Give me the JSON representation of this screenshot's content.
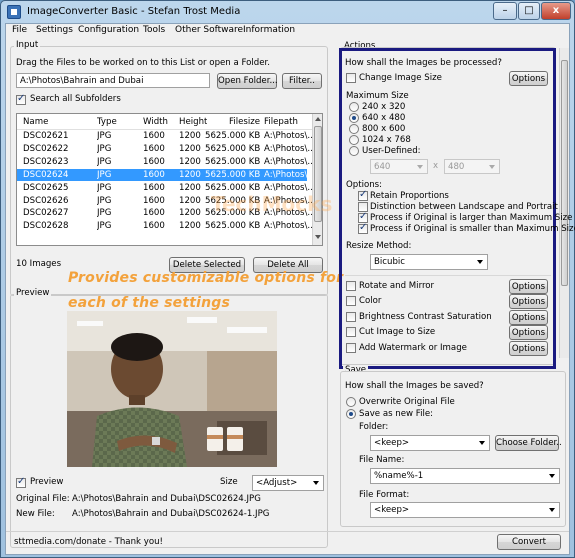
{
  "window": {
    "title": "ImageConverter Basic - Stefan Trost Media",
    "minimize": "–",
    "maximize": "□",
    "close": "x"
  },
  "menu": [
    "File",
    "Settings",
    "Configuration",
    "Tools",
    "Other Software",
    "Information"
  ],
  "input": {
    "group_label": "Input",
    "instruction": "Drag the Files to be worked on to this List or open a Folder.",
    "path": "A:\\Photos\\Bahrain and Dubai",
    "open_folder": "Open Folder...",
    "filter": "Filter..",
    "search_subfolders": "Search all Subfolders",
    "search_subfolders_checked": true,
    "columns": [
      "Name",
      "Type",
      "Width",
      "Height",
      "Filesize",
      "Filepath"
    ],
    "rows": [
      {
        "name": "DSC02621",
        "type": "JPG",
        "width": "1600",
        "height": "1200",
        "size": "5625.000 KB",
        "path": "A:\\Photos\\..."
      },
      {
        "name": "DSC02622",
        "type": "JPG",
        "width": "1600",
        "height": "1200",
        "size": "5625.000 KB",
        "path": "A:\\Photos\\..."
      },
      {
        "name": "DSC02623",
        "type": "JPG",
        "width": "1600",
        "height": "1200",
        "size": "5625.000 KB",
        "path": "A:\\Photos\\..."
      },
      {
        "name": "DSC02624",
        "type": "JPG",
        "width": "1600",
        "height": "1200",
        "size": "5625.000 KB",
        "path": "A:\\Photos\\..."
      },
      {
        "name": "DSC02625",
        "type": "JPG",
        "width": "1600",
        "height": "1200",
        "size": "5625.000 KB",
        "path": "A:\\Photos\\..."
      },
      {
        "name": "DSC02626",
        "type": "JPG",
        "width": "1600",
        "height": "1200",
        "size": "5625.000 KB",
        "path": "A:\\Photos\\..."
      },
      {
        "name": "DSC02627",
        "type": "JPG",
        "width": "1600",
        "height": "1200",
        "size": "5625.000 KB",
        "path": "A:\\Photos\\..."
      },
      {
        "name": "DSC02628",
        "type": "JPG",
        "width": "1600",
        "height": "1200",
        "size": "5625.000 KB",
        "path": "A:\\Photos\\..."
      }
    ],
    "selected_row": 3,
    "count": "10 Images",
    "delete_selected": "Delete Selected",
    "delete_all": "Delete All"
  },
  "preview": {
    "group_label": "Preview",
    "checkbox_label": "Preview",
    "checkbox_checked": true,
    "size_label": "Size",
    "size_value": "<Adjust>",
    "original_label": "Original File:",
    "original_value": "A:\\Photos\\Bahrain and Dubai\\DSC02624.JPG",
    "new_label": "New File:",
    "new_value": "A:\\Photos\\Bahrain and Dubai\\DSC02624-1.JPG"
  },
  "annotation": {
    "line1": "Provides customizable options for",
    "line2": "each of the settings",
    "color": "#f3a23c"
  },
  "watermark": "TechMocks",
  "actions": {
    "group_label": "Actions",
    "question": "How shall the Images be processed?",
    "change_size": "Change Image Size",
    "options": "Options",
    "max_size_label": "Maximum Size",
    "sizes": [
      "240 x 320",
      "640 x 480",
      "800 x 600",
      "1024 x 768",
      "User-Defined:"
    ],
    "selected_size": 1,
    "user_w": "640",
    "user_h": "480",
    "times": "x",
    "options_label": "Options:",
    "opt_retain": "Retain Proportions",
    "opt_distinction": "Distinction between Landscape and Portrait",
    "opt_larger": "Process if Original is larger than Maximum Size",
    "opt_smaller": "Process if Original is smaller than Maximum Size",
    "resize_label": "Resize Method:",
    "resize_value": "Bicubic",
    "rotate": "Rotate and Mirror",
    "color": "Color",
    "brightness": "Brightness Contrast Saturation",
    "cut": "Cut Image to Size",
    "watermark": "Add Watermark or Image",
    "highlight_color": "#1a1a80"
  },
  "save": {
    "group_label": "Save",
    "question": "How shall the Images be saved?",
    "overwrite": "Overwrite Original File",
    "save_new": "Save as new File:",
    "selected": 1,
    "folder_label": "Folder:",
    "folder_value": "<keep>",
    "choose_folder": "Choose Folder..",
    "filename_label": "File Name:",
    "filename_value": "%name%-1",
    "format_label": "File Format:",
    "format_value": "<keep>"
  },
  "status": {
    "donate": "sttmedia.com/donate - Thank you!",
    "convert": "Convert"
  }
}
